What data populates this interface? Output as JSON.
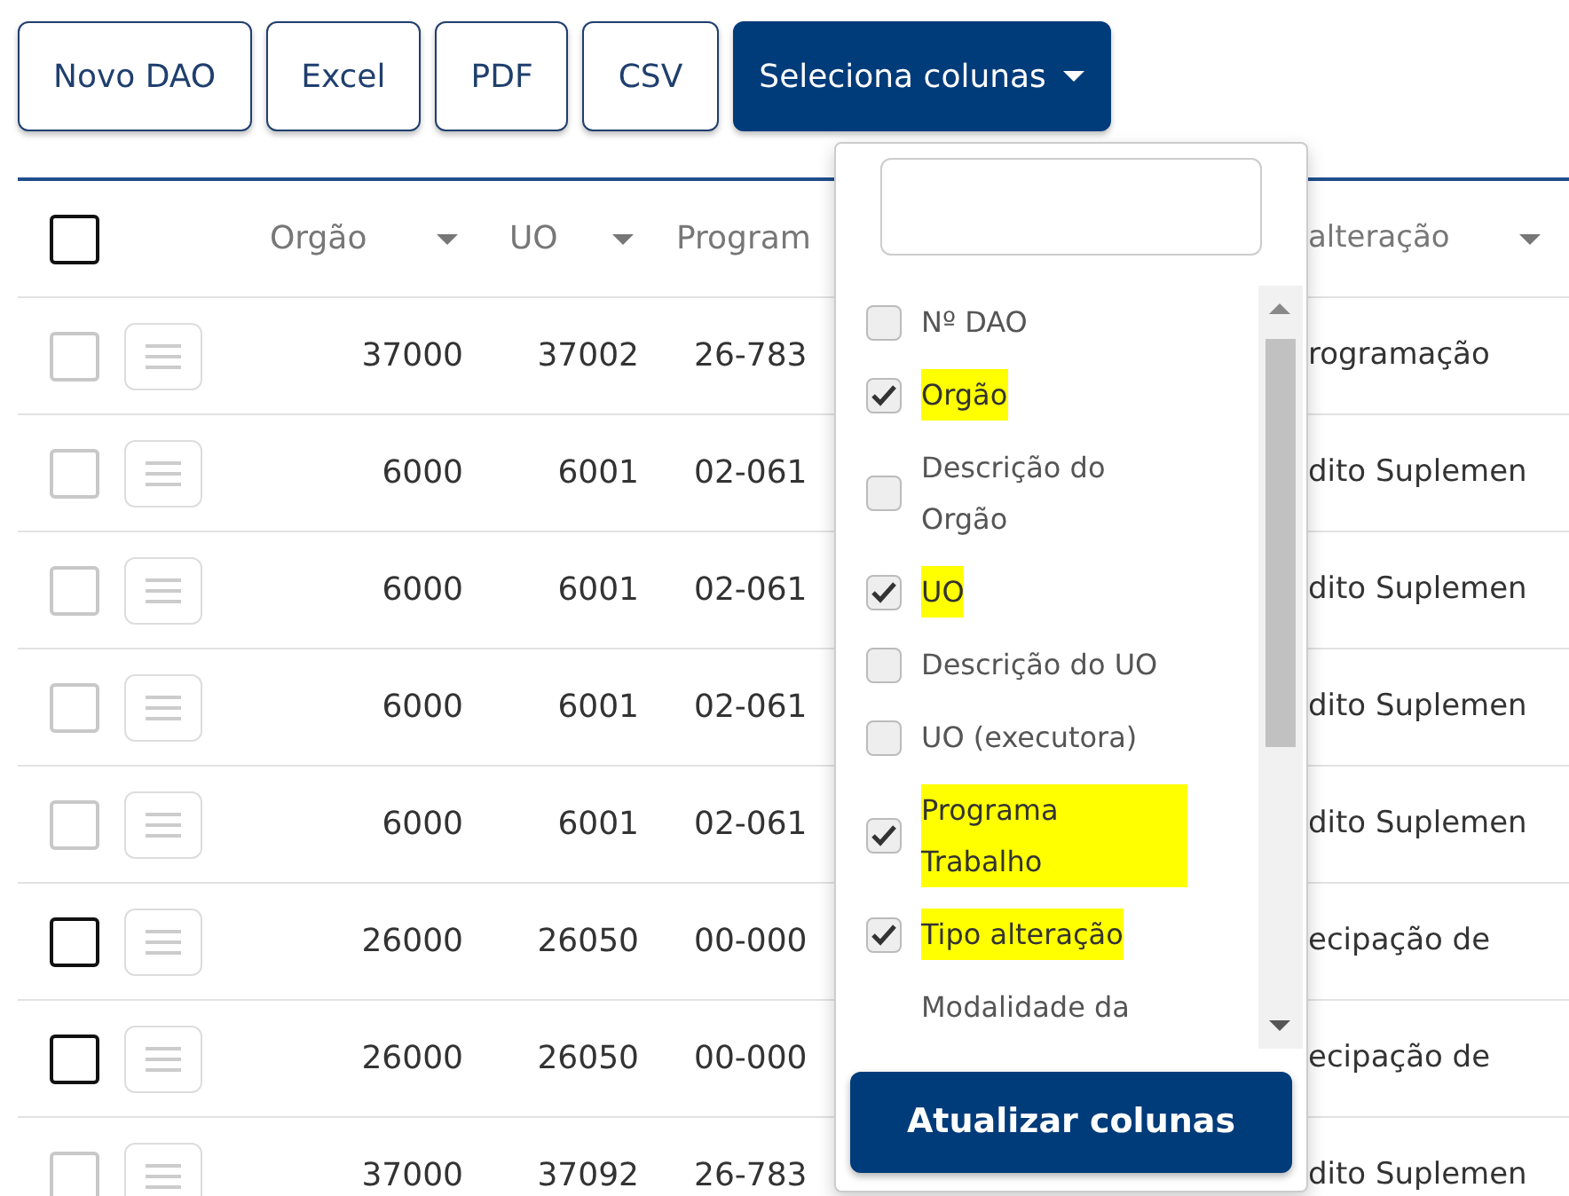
{
  "toolbar": {
    "buttons": [
      {
        "label": "Novo DAO",
        "kind": "outline"
      },
      {
        "label": "Excel",
        "kind": "outline"
      },
      {
        "label": "PDF",
        "kind": "outline"
      },
      {
        "label": "CSV",
        "kind": "outline"
      },
      {
        "label": "Seleciona colunas",
        "kind": "dropdown"
      }
    ]
  },
  "table": {
    "select_all": {
      "checked": false
    },
    "columns": [
      {
        "label": "Orgão",
        "sortable": true
      },
      {
        "label": "UO",
        "sortable": true
      },
      {
        "label": "Program",
        "sortable": false
      },
      {
        "label": "alteração",
        "sortable": true
      }
    ],
    "rows": [
      {
        "disabled": true,
        "cells": [
          "37000",
          "37002",
          "26-783",
          "rogramação"
        ]
      },
      {
        "disabled": true,
        "cells": [
          "6000",
          "6001",
          "02-061",
          "dito Suplemen"
        ]
      },
      {
        "disabled": true,
        "cells": [
          "6000",
          "6001",
          "02-061",
          "dito Suplemen"
        ]
      },
      {
        "disabled": true,
        "cells": [
          "6000",
          "6001",
          "02-061",
          "dito Suplemen"
        ]
      },
      {
        "disabled": true,
        "cells": [
          "6000",
          "6001",
          "02-061",
          "dito Suplemen"
        ]
      },
      {
        "disabled": false,
        "cells": [
          "26000",
          "26050",
          "00-000",
          "ecipação de"
        ]
      },
      {
        "disabled": false,
        "cells": [
          "26000",
          "26050",
          "00-000",
          "ecipação de"
        ]
      },
      {
        "disabled": true,
        "cells": [
          "37000",
          "37092",
          "26-783",
          "dito Suplemen"
        ]
      }
    ]
  },
  "column_menu": {
    "items": [
      {
        "label": "Nº DAO",
        "checked": false
      },
      {
        "label": "Orgão",
        "checked": true
      },
      {
        "label": "Descrição do Orgão",
        "checked": false
      },
      {
        "label": "UO",
        "checked": true
      },
      {
        "label": "Descrição do UO",
        "checked": false
      },
      {
        "label": "UO (executora)",
        "checked": false
      },
      {
        "label": "Programa Trabalho",
        "checked": true
      },
      {
        "label": "Tipo alteração",
        "checked": true
      },
      {
        "label": "Modalidade da"
      }
    ],
    "apply_button": "Atualizar colunas"
  }
}
